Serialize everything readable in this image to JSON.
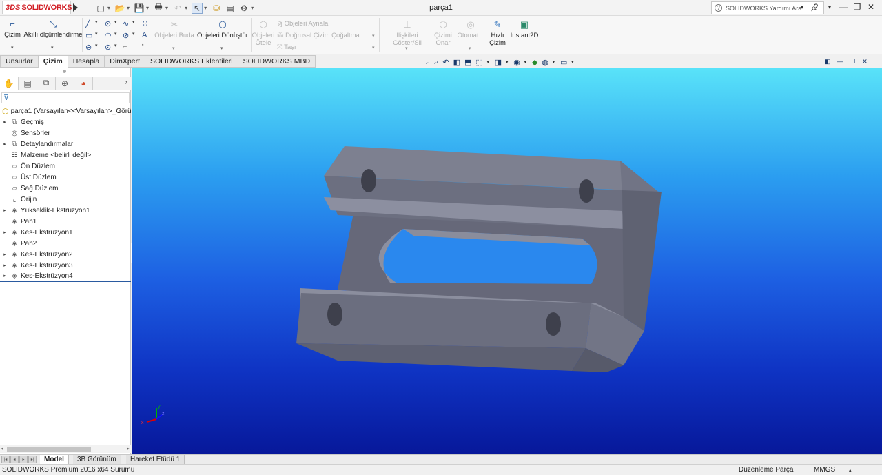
{
  "app": {
    "brand_prefix": "3DS",
    "brand_name": "SOLIDWORKS",
    "document_title": "parça1"
  },
  "quick_access": {
    "icons": [
      "new-document-icon",
      "open-icon",
      "save-icon",
      "print-icon",
      "undo-icon",
      "select-icon",
      "rebuild-icon",
      "file-properties-icon",
      "options-icon"
    ]
  },
  "help": {
    "search_text": "SOLIDWORKS Yardımı Ara",
    "question_label": "?"
  },
  "ribbon": {
    "sketch": "Çizim",
    "smart_dimension": "Akıllı ölçümlendirme",
    "trim_entities": "Objeleri Buda",
    "convert_entities": "Objeleri Dönüştür",
    "offset_entities_line1": "Objeleri",
    "offset_entities_line2": "Ötele",
    "mirror_entities": "Objeleri Aynala",
    "linear_pattern": "Doğrusal Çizim Çoğaltma",
    "move_entities": "Taşı",
    "display_relations": "İlişkileri Göster/Sil",
    "repair_sketch_line1": "Çizimi",
    "repair_sketch_line2": "Onar",
    "auto_dim": "Otomat...",
    "rapid_sketch_line1": "Hızlı",
    "rapid_sketch_line2": "Çizim",
    "instant2d": "Instant2D"
  },
  "cmd_tabs": [
    "Unsurlar",
    "Çizim",
    "Hesapla",
    "DimXpert",
    "SOLIDWORKS Eklentileri",
    "SOLIDWORKS MBD"
  ],
  "active_cmd_tab": "Çizim",
  "feature_tree": {
    "root": "parça1  (Varsayılan<<Varsayılan>_Görü",
    "items": [
      {
        "label": "Geçmiş",
        "expandable": true
      },
      {
        "label": "Sensörler",
        "expandable": false
      },
      {
        "label": "Detaylandırmalar",
        "expandable": true
      },
      {
        "label": "Malzeme <belirli değil>",
        "expandable": false
      },
      {
        "label": "Ön Düzlem",
        "expandable": false
      },
      {
        "label": "Üst Düzlem",
        "expandable": false
      },
      {
        "label": "Sağ Düzlem",
        "expandable": false
      },
      {
        "label": "Orijin",
        "expandable": false
      },
      {
        "label": "Yükseklik-Ekstrüzyon1",
        "expandable": true
      },
      {
        "label": "Pah1",
        "expandable": false
      },
      {
        "label": "Kes-Ekstrüzyon1",
        "expandable": true
      },
      {
        "label": "Pah2",
        "expandable": false
      },
      {
        "label": "Kes-Ekstrüzyon2",
        "expandable": true
      },
      {
        "label": "Kes-Ekstrüzyon3",
        "expandable": true
      },
      {
        "label": "Kes-Ekstrüzyon4",
        "expandable": true
      }
    ]
  },
  "model_tabs": [
    "Model",
    "3B Görünüm",
    "Hareket Etüdü 1"
  ],
  "active_model_tab": "Model",
  "status": {
    "version": "SOLIDWORKS Premium 2016 x64 Sürümü",
    "mode": "Düzenleme Parça",
    "units": "MMGS"
  },
  "triad": {
    "x": "x",
    "y": "y",
    "z": "z"
  },
  "colors": {
    "brand_red": "#d21f26",
    "part_gray": "#6c6f80",
    "viewport_top": "#59e3f9",
    "viewport_bottom": "#07189a"
  }
}
